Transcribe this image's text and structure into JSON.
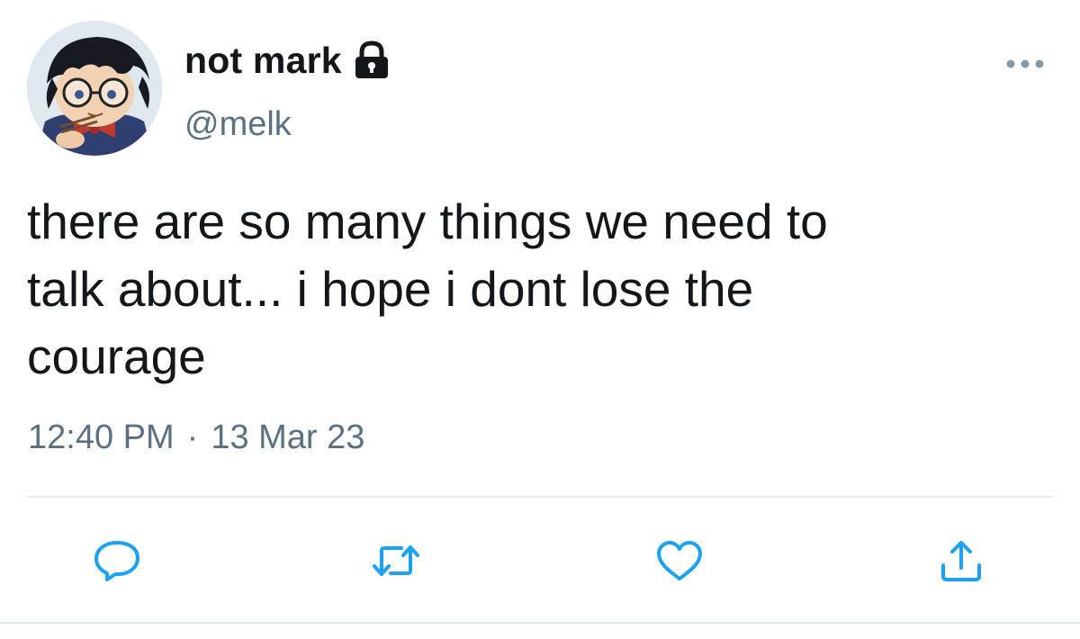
{
  "user": {
    "display_name": "not mark",
    "handle": "@melk",
    "protected_icon": "lock-icon",
    "avatar_icon": "avatar"
  },
  "tweet": {
    "text": "there are so many things we need to\ntalk about... i hope i dont lose the\ncourage",
    "time": "12:40 PM",
    "separator": "·",
    "date": "13 Mar 23"
  },
  "actions": {
    "reply_icon": "reply-icon",
    "retweet_icon": "retweet-icon",
    "like_icon": "heart-icon",
    "share_icon": "share-icon",
    "more_icon": "more-icon"
  },
  "colors": {
    "text": "#14171a",
    "secondary": "#5b7083",
    "divider": "#e1e8ed",
    "icon": "#1da1f2"
  }
}
